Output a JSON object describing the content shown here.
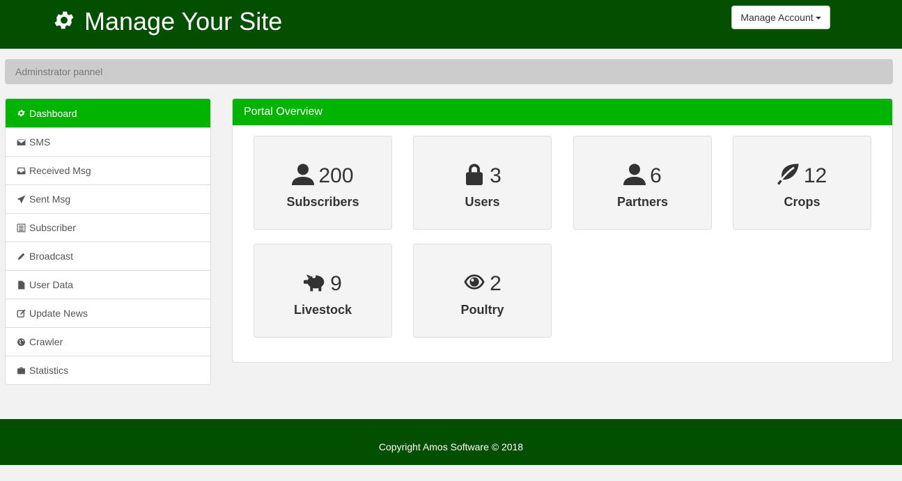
{
  "header": {
    "title": "Manage Your Site",
    "account_button": "Manage Account"
  },
  "breadcrumb": "Adminstrator pannel",
  "sidebar": {
    "items": [
      {
        "label": "Dashboard",
        "icon": "gear-icon",
        "active": true
      },
      {
        "label": "SMS",
        "icon": "envelope-icon"
      },
      {
        "label": "Received Msg",
        "icon": "inbox-icon"
      },
      {
        "label": "Sent Msg",
        "icon": "send-icon"
      },
      {
        "label": "Subscriber",
        "icon": "list-icon"
      },
      {
        "label": "Broadcast",
        "icon": "pencil-icon"
      },
      {
        "label": "User Data",
        "icon": "file-icon"
      },
      {
        "label": "Update News",
        "icon": "edit-icon"
      },
      {
        "label": "Crawler",
        "icon": "globe-icon"
      },
      {
        "label": "Statistics",
        "icon": "briefcase-icon"
      }
    ]
  },
  "panel": {
    "title": "Portal Overview",
    "stats": [
      {
        "value": "200",
        "label": "Subscribers",
        "icon": "user-icon"
      },
      {
        "value": "3",
        "label": "Users",
        "icon": "lock-icon"
      },
      {
        "value": "6",
        "label": "Partners",
        "icon": "user-icon"
      },
      {
        "value": "12",
        "label": "Crops",
        "icon": "leaf-icon"
      },
      {
        "value": "9",
        "label": "Livestock",
        "icon": "piggy-bank-icon"
      },
      {
        "value": "2",
        "label": "Poultry",
        "icon": "eye-icon"
      }
    ]
  },
  "footer": {
    "copyright": "Copyright Amos Software © 2018"
  },
  "colors": {
    "header_bg": "#034f00",
    "accent_green": "#00b400",
    "breadcrumb_bg": "#cccccc"
  }
}
